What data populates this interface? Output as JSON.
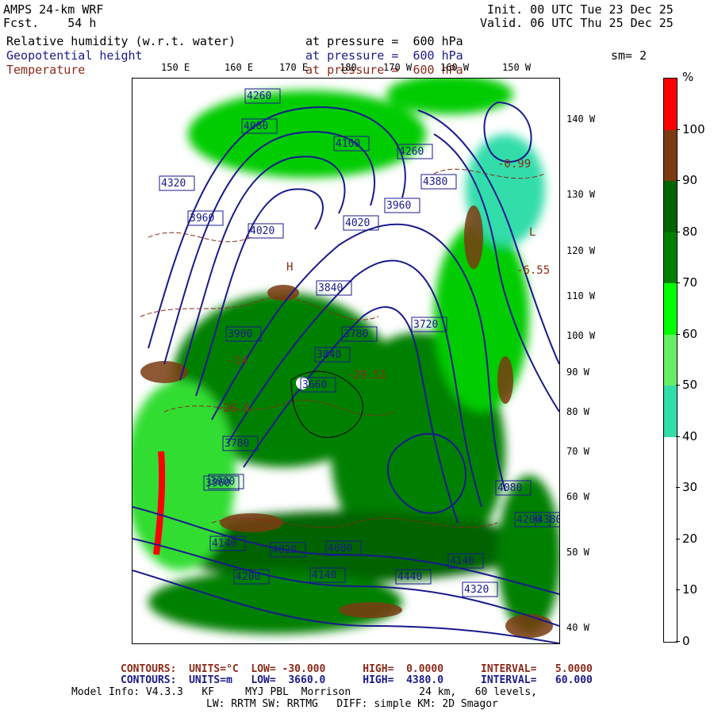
{
  "header": {
    "model": "AMPS 24-km WRF",
    "fcst_label": "Fcst.",
    "fcst_hours": "54 h",
    "init": "Init. 00 UTC Tue 23 Dec 25",
    "valid": "Valid. 06 UTC Thu 25 Dec 25"
  },
  "fields": [
    {
      "name": "Relative humidity (w.r.t. water)",
      "level": "at pressure =  600 hPa",
      "color": "#000000"
    },
    {
      "name": "Geopotential height",
      "level": "at pressure =  600 hPa",
      "color": "#1a1a8c"
    },
    {
      "name": "Temperature",
      "level": "at pressure =  600 hPa",
      "color": "#8c2a1a"
    }
  ],
  "smoothing": "sm= 2",
  "colorbar": {
    "units": "%",
    "labels": [
      "100",
      "90",
      "80",
      "70",
      "60",
      "50",
      "40",
      "30",
      "20",
      "10",
      "0"
    ],
    "colors": [
      "#ff0000",
      "#7a3b12",
      "#006400",
      "#008000",
      "#00ff00",
      "#66ee66",
      "#33ddaa",
      "#ffffff",
      "#ffffff",
      "#ffffff",
      "#ffffff"
    ]
  },
  "lon_labels_top": [
    "150 E",
    "160 E",
    "170 E",
    "180",
    "170 W",
    "160 W",
    "150 W"
  ],
  "lat_labels_right": [
    "140 W",
    "130 W",
    "120 W",
    "110 W",
    "100 W",
    "90 W",
    "80 W",
    "70 W",
    "60 W",
    "50 W",
    "40 W"
  ],
  "height_contour_labels": [
    "4260",
    "4080",
    "4160",
    "4260",
    "4380",
    "4020",
    "3960",
    "4020",
    "4320",
    "3960",
    "3840",
    "3780",
    "3720",
    "3900",
    "3840",
    "3660",
    "3780",
    "3900",
    "4080",
    "4200",
    "4140",
    "4140",
    "4440",
    "4320",
    "4200",
    "4020",
    "3960",
    "4080",
    "4140",
    "4380"
  ],
  "temperature_labels": [
    "-14",
    "-29.51",
    "-26.5",
    "-6.55",
    "-0.99",
    "L",
    "H"
  ],
  "footer": {
    "temp_contours": {
      "label": "CONTOURS:",
      "units": "UNITS=°C",
      "low": "LOW= -30.000",
      "high": "HIGH=  0.0000",
      "interval": "INTERVAL=   5.0000"
    },
    "height_contours": {
      "label": "CONTOURS:",
      "units": "UNITS=m",
      "low": "LOW=  3660.0",
      "high": "HIGH=  4380.0",
      "interval": "INTERVAL=   60.000"
    },
    "model_info_1": "Model Info: V4.3.3   KF     MYJ PBL  Morrison           24 km,   60 levels,",
    "model_info_2": "LW: RRTM SW: RRTMG   DIFF: simple KM: 2D Smagor"
  }
}
